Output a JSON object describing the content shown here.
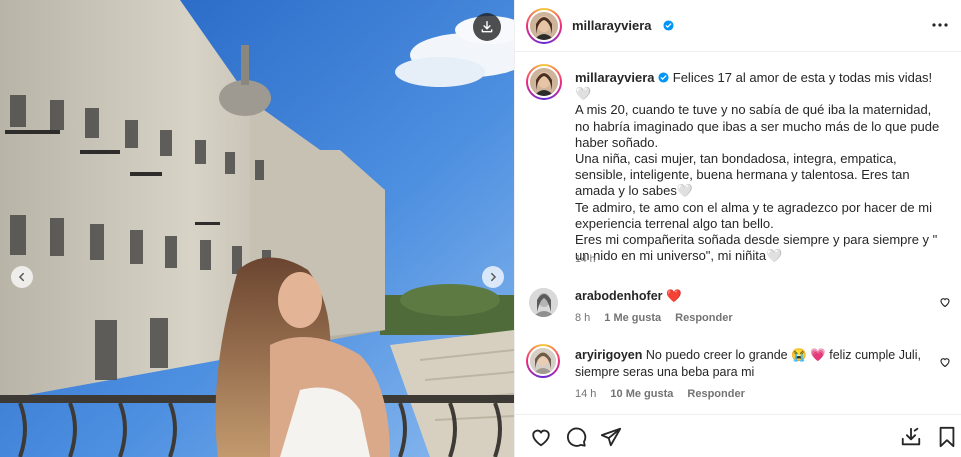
{
  "post": {
    "author": "millarayviera",
    "verified_icon": "verified-badge-icon",
    "more_icon": "more-options-icon"
  },
  "media": {
    "download_icon": "download-icon",
    "prev_icon": "chevron-left-icon",
    "next_icon": "chevron-right-icon"
  },
  "caption": {
    "username": "millarayviera",
    "lines": [
      "Felices 17 al amor de esta y todas mis vidas!",
      "A mis 20, cuando te tuve y no sabía de qué iba la maternidad, no habría imaginado que ibas a ser mucho más de lo que pude haber soñado.",
      "Una niña, casi mujer, tan bondadosa, integra, empatica, sensible, inteligente, buena hermana y talentosa. Eres tan amada y lo sabes",
      "Te admiro, te amo con el alma y te agradezco por hacer de mi experiencia terrenal algo tan bello.",
      "Eres mi compañerita soñada desde siempre y para siempre y \" un nido en mi universo\", mi niñita"
    ],
    "heart_glyph": "🤍",
    "time": "14 h"
  },
  "comments": [
    {
      "username": "arabodenhofer",
      "text": "",
      "emoji": "❤️",
      "time": "8 h",
      "likes": "1 Me gusta",
      "reply": "Responder"
    },
    {
      "username": "aryirigoyen",
      "text_a": "No puedo creer lo grande",
      "emoji_a": "😭",
      "emoji_b": "💗",
      "text_b": "feliz cumple Juli, siempre seras una beba para mi",
      "time": "14 h",
      "likes": "10 Me gusta",
      "reply": "Responder"
    }
  ],
  "actions": {
    "like_icon": "heart-outline-icon",
    "comment_icon": "comment-icon",
    "share_icon": "share-icon",
    "save_post_icon": "download-tray-icon",
    "bookmark_icon": "bookmark-icon"
  },
  "colors": {
    "verified": "#0095f6",
    "heart_red": "#ed4956",
    "muted_text": "#737373",
    "border": "#efefef"
  }
}
